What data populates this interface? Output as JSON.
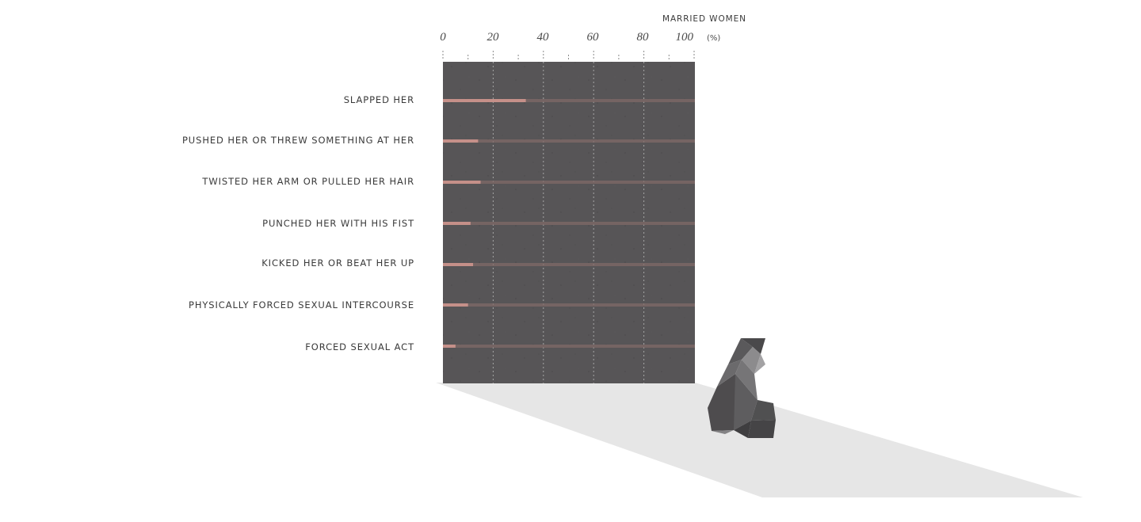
{
  "chart_data": {
    "type": "bar",
    "orientation": "horizontal",
    "series": [
      {
        "name": "MARRIED WOMEN",
        "values": [
          33,
          14,
          15,
          11,
          12,
          10,
          5
        ]
      }
    ],
    "categories": [
      "SLAPPED HER",
      "PUSHED HER OR THREW SOMETHING AT HER",
      "TWISTED HER ARM OR PULLED HER HAIR",
      "PUNCHED HER WITH HIS FIST",
      "KICKED HER OR BEAT HER UP",
      "PHYSICALLY  FORCED SEXUAL INTERCOURSE",
      "FORCED SEXUAL ACT"
    ],
    "x_ticks": [
      "0",
      "20",
      "40",
      "60",
      "80",
      "100"
    ],
    "x_unit": "(%)",
    "xlim": [
      0,
      100
    ],
    "axis_position": "top",
    "grid": true,
    "colors": {
      "panel": "#575557",
      "bar": "#c59089",
      "track": "#7f6967",
      "grid": "#b9b9b9",
      "shadow": "#e6e6e6",
      "figure": "#525152"
    }
  }
}
